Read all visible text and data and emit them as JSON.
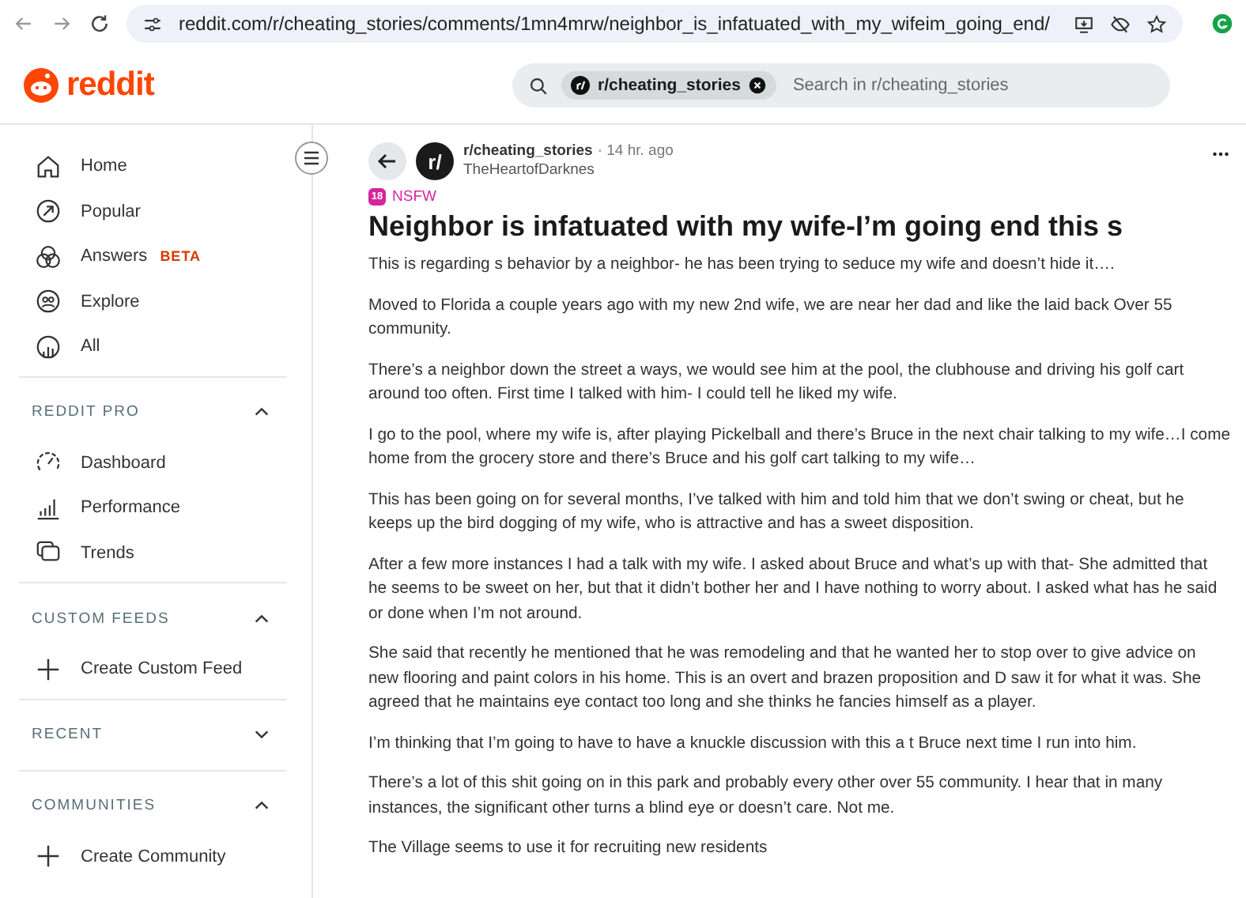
{
  "browser": {
    "url": "reddit.com/r/cheating_stories/comments/1mn4mrw/neighbor_is_infatuated_with_my_wifeim_going_end/"
  },
  "header": {
    "logo": "reddit",
    "search": {
      "chip": "r/cheating_stories",
      "placeholder": "Search in r/cheating_stories"
    }
  },
  "sidebar": {
    "items": [
      {
        "label": "Home"
      },
      {
        "label": "Popular"
      },
      {
        "label": "Answers",
        "badge": "BETA"
      },
      {
        "label": "Explore"
      },
      {
        "label": "All"
      }
    ],
    "sections": [
      {
        "title": "REDDIT PRO",
        "expanded": true,
        "items": [
          {
            "label": "Dashboard"
          },
          {
            "label": "Performance"
          },
          {
            "label": "Trends"
          }
        ]
      },
      {
        "title": "CUSTOM FEEDS",
        "expanded": true,
        "items": [
          {
            "label": "Create Custom Feed"
          }
        ]
      },
      {
        "title": "RECENT",
        "expanded": false
      },
      {
        "title": "COMMUNITIES",
        "expanded": true,
        "items": [
          {
            "label": "Create Community"
          }
        ]
      }
    ]
  },
  "post": {
    "avatar": "r/",
    "subreddit": "r/cheating_stories",
    "age": "· 14 hr. ago",
    "author": "TheHeartofDarknes",
    "flair_icon": "18",
    "flair": "NSFW",
    "title": "Neighbor is infatuated with my wife-I’m going end this s",
    "paragraphs": [
      "This is regarding s behavior by a neighbor- he has been trying to seduce my wife and doesn’t hide it….",
      "Moved to Florida a couple years ago with my new 2nd wife, we are near her dad and like the laid back Over 55 community.",
      "There’s a neighbor down the street a ways, we would see him at the pool, the clubhouse and driving his golf cart around too often. First time I talked with him- I could tell he liked my wife.",
      "I go to the pool, where my wife is, after playing Pickelball and there’s Bruce in the next chair talking to my wife…I come home from the grocery store and there’s Bruce and his golf cart talking to my wife…",
      "This has been going on for several months, I’ve talked with him and told him that we don’t swing or cheat, but he keeps up the bird dogging of my wife, who is attractive and has a sweet disposition.",
      "After a few more instances I had a talk with my wife. I asked about Bruce and what’s up with that- She admitted that he seems to be sweet on her, but that it didn’t bother her and I have nothing to worry about. I asked what has he said or done when I’m not around.",
      "She said that recently he mentioned that he was remodeling and that he wanted her to stop over to give advice on new flooring and paint colors in his home. This is an overt and brazen proposition and D saw it for what it was. She agreed that he maintains eye contact too long and she thinks he fancies himself as a player.",
      "I’m thinking that I’m going to have to have a knuckle discussion with this a t Bruce next time I run into him.",
      "There’s a lot of this shit going on in this park and probably every other over 55 community. I hear that in many instances, the significant other turns a blind eye or doesn’t care. Not me.",
      "The Village seems to use it for recruiting new residents"
    ]
  }
}
